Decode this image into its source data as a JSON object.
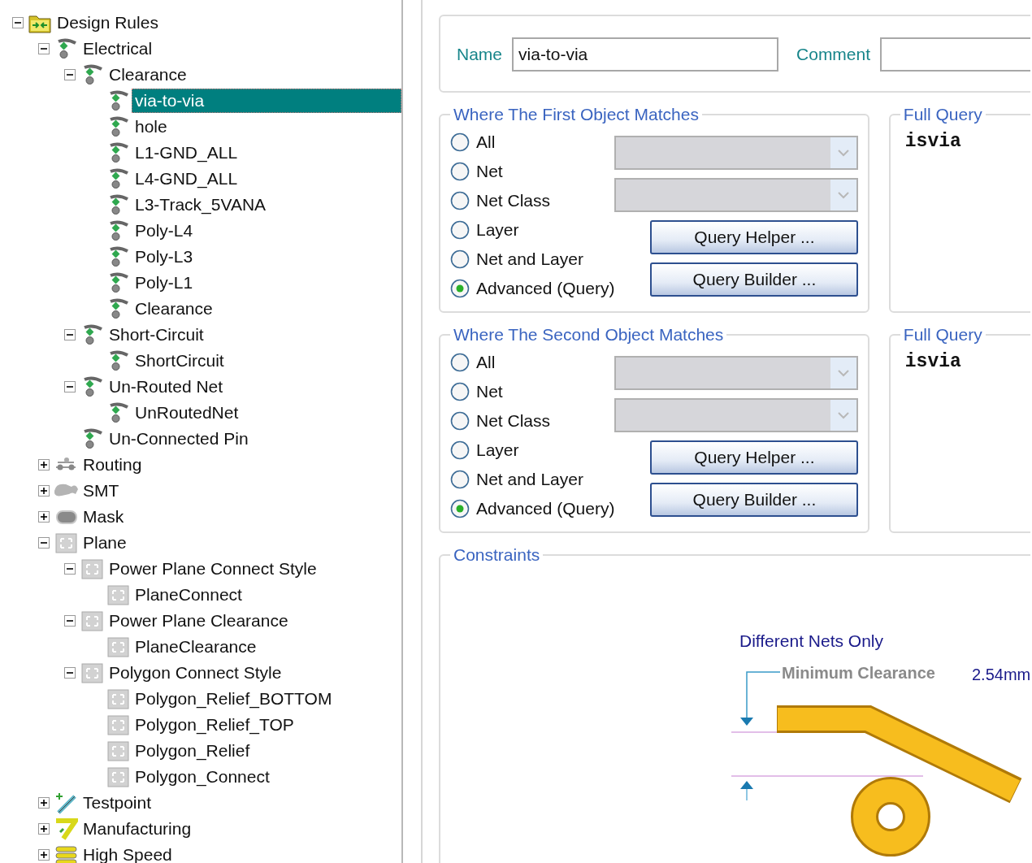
{
  "tree": [
    {
      "label": "Design Rules",
      "kind": "folder",
      "expanded": true,
      "selected": false,
      "children": [
        {
          "label": "Electrical",
          "kind": "electrical",
          "expanded": true,
          "selected": false,
          "children": [
            {
              "label": "Clearance",
              "kind": "electrical",
              "expanded": true,
              "selected": false,
              "children": [
                {
                  "label": "via-to-via",
                  "kind": "electrical",
                  "selected": true
                },
                {
                  "label": "hole",
                  "kind": "electrical",
                  "selected": false
                },
                {
                  "label": "L1-GND_ALL",
                  "kind": "electrical",
                  "selected": false
                },
                {
                  "label": "L4-GND_ALL",
                  "kind": "electrical",
                  "selected": false
                },
                {
                  "label": "L3-Track_5VANA",
                  "kind": "electrical",
                  "selected": false
                },
                {
                  "label": "Poly-L4",
                  "kind": "electrical",
                  "selected": false
                },
                {
                  "label": "Poly-L3",
                  "kind": "electrical",
                  "selected": false
                },
                {
                  "label": "Poly-L1",
                  "kind": "electrical",
                  "selected": false
                },
                {
                  "label": "Clearance",
                  "kind": "electrical",
                  "selected": false
                }
              ]
            },
            {
              "label": "Short-Circuit",
              "kind": "electrical",
              "expanded": true,
              "selected": false,
              "children": [
                {
                  "label": "ShortCircuit",
                  "kind": "electrical",
                  "selected": false
                }
              ]
            },
            {
              "label": "Un-Routed Net",
              "kind": "electrical",
              "expanded": true,
              "selected": false,
              "children": [
                {
                  "label": "UnRoutedNet",
                  "kind": "electrical",
                  "selected": false
                }
              ]
            },
            {
              "label": "Un-Connected Pin",
              "kind": "electrical",
              "selected": false
            }
          ]
        },
        {
          "label": "Routing",
          "kind": "routing",
          "expanded": false,
          "selected": false
        },
        {
          "label": "SMT",
          "kind": "smt",
          "expanded": false,
          "selected": false
        },
        {
          "label": "Mask",
          "kind": "mask",
          "expanded": false,
          "selected": false
        },
        {
          "label": "Plane",
          "kind": "plane",
          "expanded": true,
          "selected": false,
          "children": [
            {
              "label": "Power Plane Connect Style",
              "kind": "plane",
              "expanded": true,
              "selected": false,
              "children": [
                {
                  "label": "PlaneConnect",
                  "kind": "plane",
                  "selected": false
                }
              ]
            },
            {
              "label": "Power Plane Clearance",
              "kind": "plane",
              "expanded": true,
              "selected": false,
              "children": [
                {
                  "label": "PlaneClearance",
                  "kind": "plane",
                  "selected": false
                }
              ]
            },
            {
              "label": "Polygon Connect Style",
              "kind": "plane",
              "expanded": true,
              "selected": false,
              "children": [
                {
                  "label": "Polygon_Relief_BOTTOM",
                  "kind": "plane",
                  "selected": false
                },
                {
                  "label": "Polygon_Relief_TOP",
                  "kind": "plane",
                  "selected": false
                },
                {
                  "label": "Polygon_Relief",
                  "kind": "plane",
                  "selected": false
                },
                {
                  "label": "Polygon_Connect",
                  "kind": "plane",
                  "selected": false
                }
              ]
            }
          ]
        },
        {
          "label": "Testpoint",
          "kind": "testpoint",
          "expanded": false,
          "selected": false
        },
        {
          "label": "Manufacturing",
          "kind": "manufacturing",
          "expanded": false,
          "selected": false
        },
        {
          "label": "High Speed",
          "kind": "highspeed",
          "expanded": false,
          "selected": false
        }
      ]
    }
  ],
  "rule": {
    "name_label": "Name",
    "name_value": "via-to-via",
    "comment_label": "Comment"
  },
  "scopes": [
    {
      "title": "Where The First Object Matches",
      "options": [
        {
          "label": "All",
          "selected": false
        },
        {
          "label": "Net",
          "selected": false
        },
        {
          "label": "Net Class",
          "selected": false
        },
        {
          "label": "Layer",
          "selected": false
        },
        {
          "label": "Net and Layer",
          "selected": false
        },
        {
          "label": "Advanced (Query)",
          "selected": true
        }
      ],
      "dropdowns": [
        {
          "disabled": true
        },
        {
          "disabled": true
        }
      ],
      "buttons": [
        "Query Helper ...",
        "Query Builder ..."
      ],
      "full_query": {
        "title": "Full Query",
        "text": "isvia"
      }
    },
    {
      "title": "Where The Second Object Matches",
      "options": [
        {
          "label": "All",
          "selected": false
        },
        {
          "label": "Net",
          "selected": false
        },
        {
          "label": "Net Class",
          "selected": false
        },
        {
          "label": "Layer",
          "selected": false
        },
        {
          "label": "Net and Layer",
          "selected": false
        },
        {
          "label": "Advanced (Query)",
          "selected": true
        }
      ],
      "dropdowns": [
        {
          "disabled": true
        },
        {
          "disabled": true
        }
      ],
      "buttons": [
        "Query Helper ...",
        "Query Builder ..."
      ],
      "full_query": {
        "title": "Full Query",
        "text": "isvia"
      }
    }
  ],
  "constraints": {
    "title": "Constraints",
    "note": "Different Nets Only",
    "label": "Minimum Clearance",
    "value": "2.54mm"
  }
}
